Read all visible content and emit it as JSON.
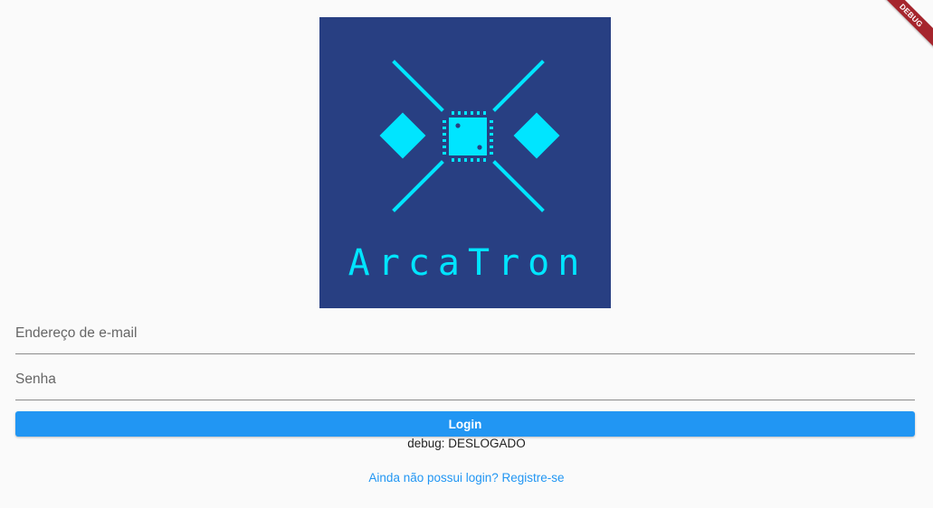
{
  "debug_banner": {
    "label": "DEBUG"
  },
  "logo": {
    "text": "ArcaTron",
    "background_color": "#283f82",
    "accent_color": "#00e5ff"
  },
  "form": {
    "email_placeholder": "Endereço de e-mail",
    "email_value": "",
    "password_placeholder": "Senha",
    "password_value": "",
    "login_label": "Login"
  },
  "status": {
    "text": "debug: DESLOGADO"
  },
  "register_link": {
    "text": "Ainda não possui login? Registre-se"
  },
  "colors": {
    "primary": "#2196f3",
    "page_background": "#fafafa",
    "debug_ribbon": "#a5252d"
  }
}
